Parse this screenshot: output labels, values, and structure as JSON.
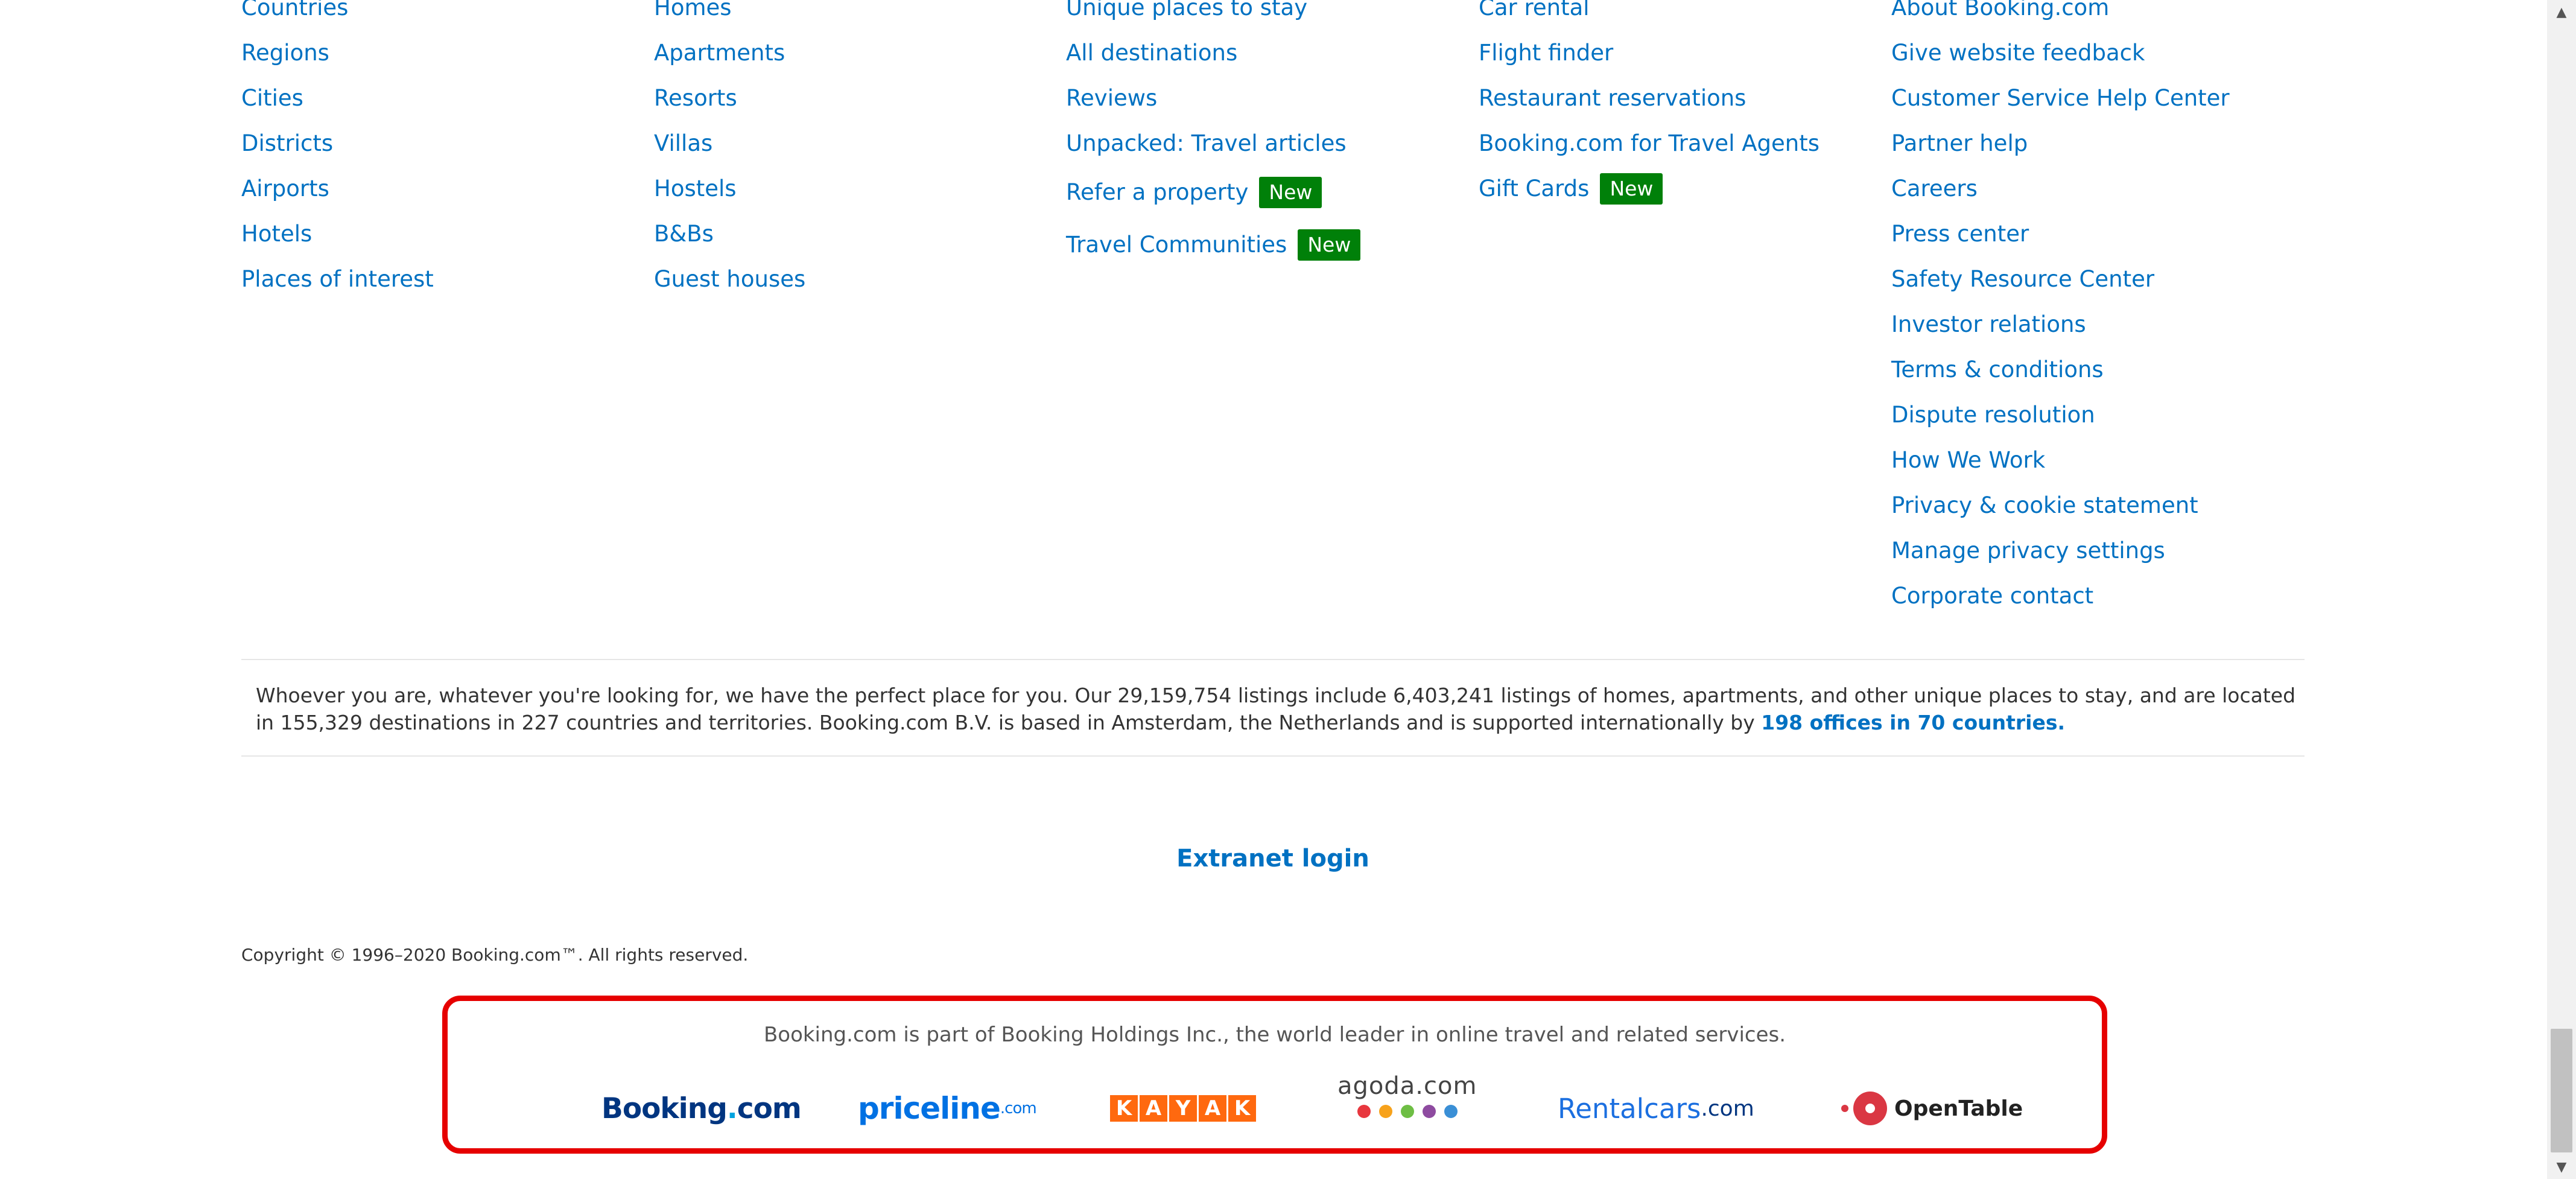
{
  "footer": {
    "col1": [
      "Countries",
      "Regions",
      "Cities",
      "Districts",
      "Airports",
      "Hotels",
      "Places of interest"
    ],
    "col2": [
      "Homes",
      "Apartments",
      "Resorts",
      "Villas",
      "Hostels",
      "B&Bs",
      "Guest houses"
    ],
    "col3": [
      {
        "label": "Unique places to stay"
      },
      {
        "label": "All destinations"
      },
      {
        "label": "Reviews"
      },
      {
        "label": "Unpacked: Travel articles"
      },
      {
        "label": "Refer a property",
        "badge": "New"
      },
      {
        "label": "Travel Communities",
        "badge": "New"
      }
    ],
    "col4": [
      {
        "label": "Car rental"
      },
      {
        "label": "Flight finder"
      },
      {
        "label": "Restaurant reservations"
      },
      {
        "label": "Booking.com for Travel Agents"
      },
      {
        "label": "Gift Cards",
        "badge": "New"
      }
    ],
    "col5": [
      "About Booking.com",
      "Give website feedback",
      "Customer Service Help Center",
      "Partner help",
      "Careers",
      "Press center",
      "Safety Resource Center",
      "Investor relations",
      "Terms & conditions",
      "Dispute resolution",
      "How We Work",
      "Privacy & cookie statement",
      "Manage privacy settings",
      "Corporate contact"
    ]
  },
  "info": {
    "text": "Whoever you are, whatever you're looking for, we have the perfect place for you. Our 29,159,754 listings include 6,403,241 listings of homes, apartments, and other unique places to stay, and are located in 155,329 destinations in 227 countries and territories. Booking.com B.V. is based in Amsterdam, the Netherlands and is supported internationally by ",
    "link": "198 offices in 70 countries."
  },
  "extranet_login": "Extranet login",
  "copyright": "Copyright © 1996–2020 Booking.com™. All rights reserved.",
  "holdings": {
    "text": "Booking.com is part of Booking Holdings Inc., the world leader in online travel and related services.",
    "brands": {
      "booking": {
        "main": "Booking",
        "dot": ".",
        "tld": "com"
      },
      "priceline": {
        "main": "priceline",
        "tld": ".com"
      },
      "kayak": [
        "K",
        "A",
        "Y",
        "A",
        "K"
      ],
      "agoda": "agoda.com",
      "rentalcars": {
        "main": "Rentalcars",
        "tld": ".com"
      },
      "opentable": "OpenTable"
    }
  },
  "colors": {
    "link": "#0071c2",
    "badge": "#008009",
    "highlight_border": "#e60000",
    "agoda_dots": [
      "#e8373e",
      "#f7a21b",
      "#6ebe44",
      "#8e4ba0",
      "#3a8fd6"
    ]
  },
  "scrollbar": {
    "up_arrow": "▲",
    "down_arrow": "▼"
  }
}
